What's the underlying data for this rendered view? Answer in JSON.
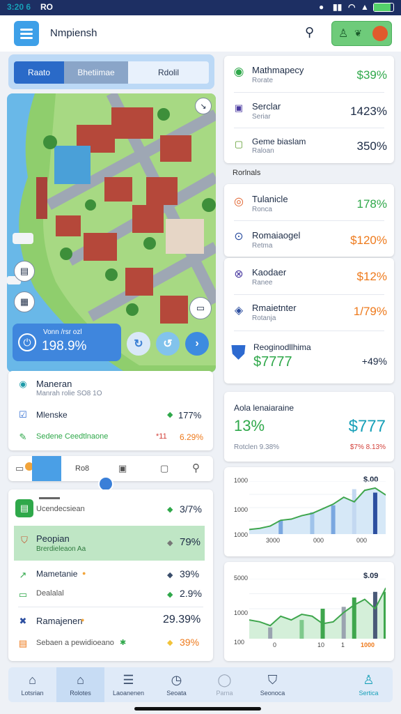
{
  "status": {
    "time": "3:20 6",
    "carrier": "RO"
  },
  "header": {
    "title": "Nmpiensh"
  },
  "segment": {
    "tabs": [
      "Raato",
      "Bhetiimae",
      "Rdolil"
    ]
  },
  "map": {
    "stat_label": "Vonn /rsr ozl",
    "stat_value": "198.9%"
  },
  "right_top": {
    "items": [
      {
        "label": "Mathmapecy",
        "sub": "Rorate",
        "value": "$39%",
        "color": "g"
      },
      {
        "label": "Serclar",
        "sub": "Seriar",
        "value": "1423%",
        "color": "b"
      },
      {
        "label": "Geme biaslam",
        "sub": "Raloan",
        "value": "350%",
        "color": "b"
      }
    ]
  },
  "section_label": "Rorlnals",
  "right_mid": {
    "items": [
      {
        "label": "Tulanicle",
        "sub": "Ronca",
        "value": "178%",
        "color": "g"
      },
      {
        "label": "Romaiaogel",
        "sub": "Retma",
        "value": "$120%",
        "color": "o"
      },
      {
        "label": "Kaodaer",
        "sub": "Ranee",
        "value": "$12%",
        "color": "o"
      },
      {
        "label": "Rmaietnter",
        "sub": "Rotanja",
        "value": "1/79%",
        "color": "o"
      }
    ],
    "feature": {
      "label": "Reoginodllhima",
      "value": "$7777",
      "delta": "+49%"
    }
  },
  "summary": {
    "title": "Aola lenaiaraine",
    "left_value": "13%",
    "right_value": "$777",
    "left_sub": "Rotclen 9.38%",
    "right_sub": "$7% 8.13%"
  },
  "left_list": {
    "title": "Maneran",
    "sub": "Manrah rolie SO8 1O",
    "row1": {
      "label": "Mlenske",
      "value": "177%"
    },
    "row2": {
      "label": "Sedene Ceedtlnaone",
      "value1": "*11",
      "value2": "6.29%"
    }
  },
  "tool_tabs": [
    "Ro8",
    "",
    ""
  ],
  "left_lower": {
    "items": [
      {
        "label": "Ucendecsiean",
        "sub": "",
        "value": "3/7%",
        "color": "b"
      },
      {
        "label": "Peopian",
        "sub": "Brerdieleaon Aa",
        "value": "79%",
        "color": "b"
      },
      {
        "label": "Mametanie",
        "sub": "",
        "value": "39%",
        "color": "b"
      },
      {
        "label": "Dealalal",
        "sub": "",
        "value": "2.9%",
        "color": "b"
      },
      {
        "label": "Ramajenen",
        "sub": "",
        "value": "29.39%",
        "color": "b"
      },
      {
        "label": "Sebaen a pewidioeano",
        "sub": "",
        "value": "39%",
        "color": "o"
      }
    ]
  },
  "chart_top": {
    "yticks": [
      "1000",
      "1000",
      "1000"
    ],
    "xticks": [
      "3000",
      "000",
      "000"
    ],
    "annotation": "$.00"
  },
  "chart_bottom": {
    "yticks": [
      "5000",
      "1000",
      "100"
    ],
    "xticks": [
      "0",
      "10",
      "1"
    ],
    "annotation": "$.09",
    "last_tick": "1000"
  },
  "nav": {
    "items": [
      {
        "label": "Lotsrian"
      },
      {
        "label": "Rolotes"
      },
      {
        "label": "Laoanenen"
      },
      {
        "label": "Seoata"
      },
      {
        "label": "Parna"
      },
      {
        "label": "Seonoca"
      },
      {
        "label": "Sertica"
      }
    ]
  },
  "chart_data": [
    {
      "type": "line",
      "x": [
        0,
        1,
        2,
        3,
        4,
        5,
        6,
        7,
        8,
        9,
        10,
        11,
        12,
        13
      ],
      "values": [
        0.2,
        0.25,
        0.35,
        0.6,
        0.65,
        0.8,
        0.9,
        1.1,
        1.3,
        1.6,
        1.4,
        1.9,
        2.0,
        1.7
      ],
      "bars": [
        [
          3,
          0.6
        ],
        [
          6,
          0.95
        ],
        [
          8,
          1.25
        ],
        [
          10,
          1.95
        ],
        [
          12,
          1.8
        ]
      ],
      "annotation": "$.00",
      "ylim": [
        0,
        2.3
      ]
    },
    {
      "type": "line",
      "x": [
        0,
        1,
        2,
        3,
        4,
        5,
        6,
        7,
        8,
        9,
        10,
        11,
        12,
        13
      ],
      "values": [
        1.0,
        0.9,
        0.7,
        1.2,
        1.0,
        1.3,
        1.2,
        0.8,
        0.9,
        1.4,
        1.8,
        2.1,
        1.6,
        2.7
      ],
      "bars": [
        [
          2,
          0.6
        ],
        [
          5,
          1.0
        ],
        [
          7,
          1.6
        ],
        [
          9,
          1.7
        ],
        [
          10,
          2.2
        ],
        [
          12,
          2.5
        ],
        [
          13,
          2.5
        ]
      ],
      "annotation": "$.09",
      "ylim": [
        0,
        3.2
      ]
    }
  ]
}
